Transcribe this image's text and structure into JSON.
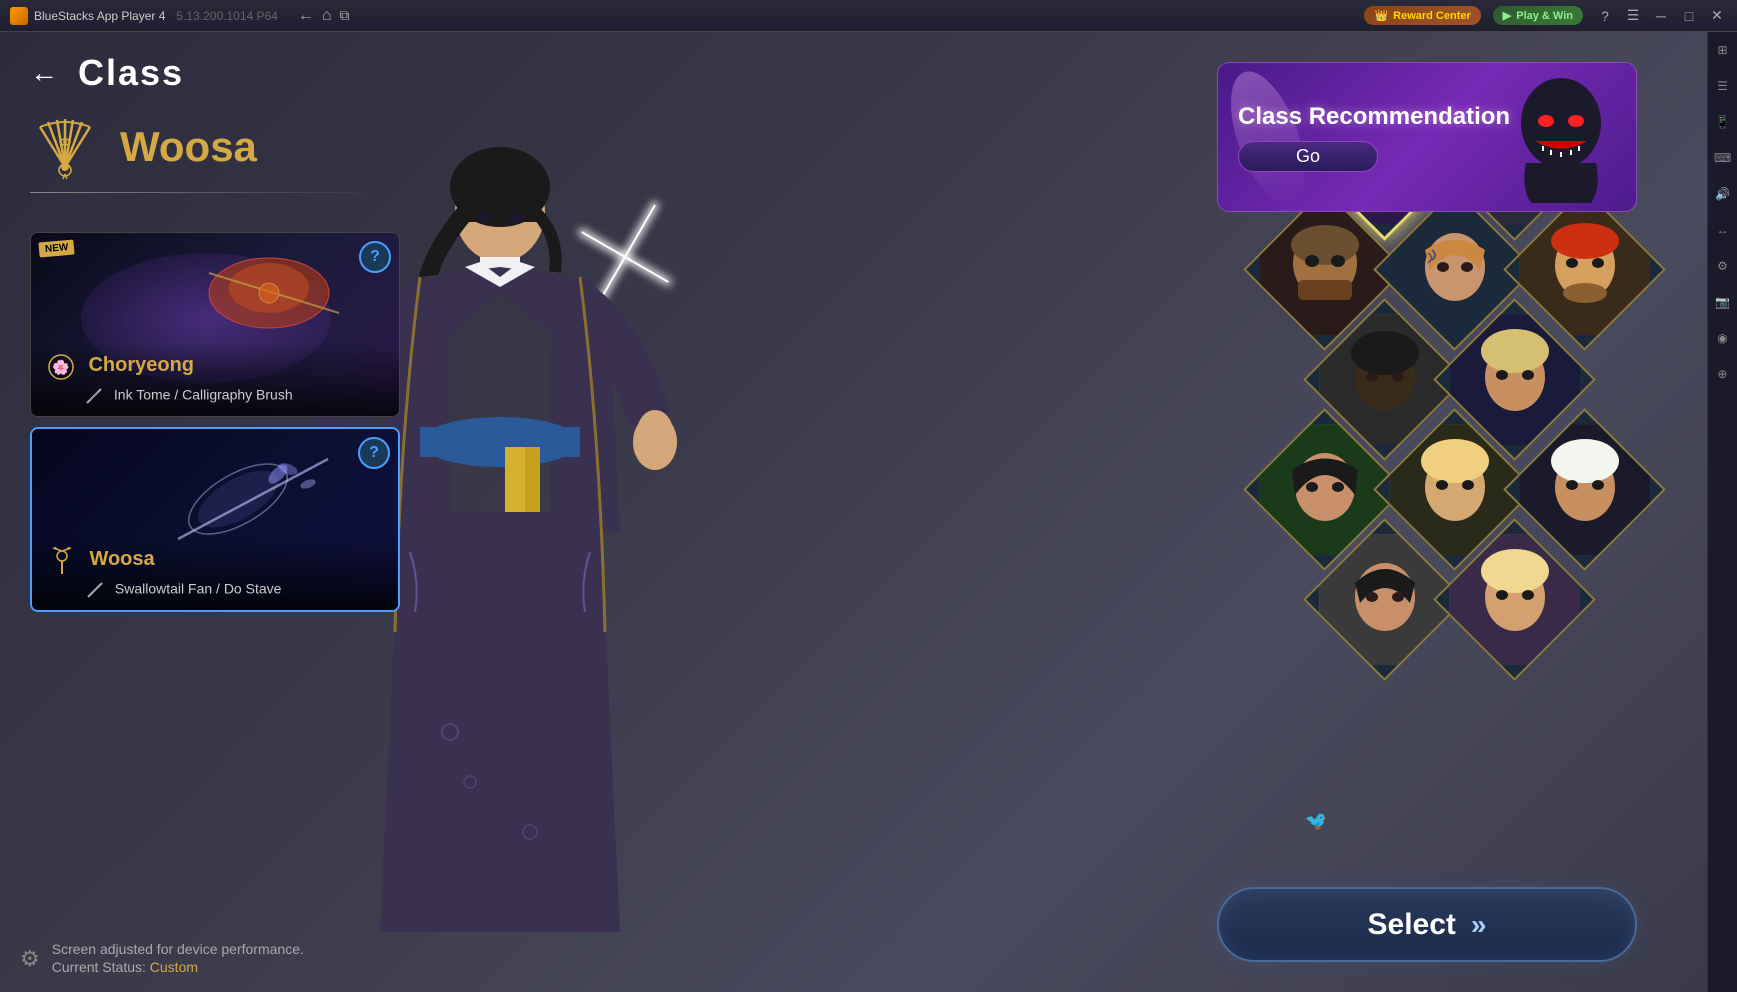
{
  "titleBar": {
    "appName": "BlueStacks App Player 4",
    "version": "5.13.200.1014 P64",
    "rewardCenter": "Reward Center",
    "playWin": "Play & Win",
    "navBack": "←",
    "navHome": "⌂",
    "navCopy": "⧉"
  },
  "header": {
    "backArrow": "←",
    "title": "Class"
  },
  "classInfo": {
    "name": "Woosa",
    "selectedClass": "Woosa",
    "divider": ""
  },
  "classCards": [
    {
      "id": "choryeong",
      "isNew": true,
      "name": "Choryeong",
      "weapon": "Ink Tome / Calligraphy Brush",
      "selected": false
    },
    {
      "id": "woosa",
      "isNew": false,
      "name": "Woosa",
      "weapon": "Swallowtail Fan / Do Stave",
      "selected": true
    }
  ],
  "recommendation": {
    "title": "Class Recommendation",
    "goButton": "Go"
  },
  "selectButton": {
    "label": "Select",
    "chevron": "»"
  },
  "statusBar": {
    "line1": "Screen adjusted for device performance.",
    "line2": "Current Status: ",
    "status": "Custom"
  },
  "questionMark": "?",
  "newBadge": "NEW",
  "classGrid": {
    "items": [
      {
        "id": "woosa",
        "isNew": true,
        "selected": true,
        "emoji": "👩",
        "color": "#4a3a6a"
      },
      {
        "id": "char2",
        "isNew": false,
        "selected": false,
        "emoji": "👱‍♀️",
        "color": "#3a3a4a"
      },
      {
        "id": "char3",
        "isNew": false,
        "selected": false,
        "emoji": "👴",
        "color": "#3a2a2a"
      },
      {
        "id": "char4",
        "isNew": false,
        "selected": false,
        "emoji": "👱‍♀️",
        "color": "#3a3a2a"
      },
      {
        "id": "char5",
        "isNew": false,
        "selected": false,
        "emoji": "🧔",
        "color": "#2a3a4a"
      },
      {
        "id": "char6",
        "isNew": false,
        "selected": false,
        "emoji": "👩‍🦰",
        "color": "#3a2a3a"
      },
      {
        "id": "char7",
        "isNew": false,
        "selected": false,
        "emoji": "👨‍🦱",
        "color": "#2a2a2a"
      },
      {
        "id": "char8",
        "isNew": false,
        "selected": false,
        "emoji": "👩‍🦳",
        "color": "#3a2a1a"
      },
      {
        "id": "char9",
        "isNew": false,
        "selected": false,
        "emoji": "👩",
        "color": "#2a3a2a"
      },
      {
        "id": "char10",
        "isNew": false,
        "selected": false,
        "emoji": "👱‍♀️",
        "color": "#2a2a3a"
      },
      {
        "id": "char11",
        "isNew": false,
        "selected": false,
        "emoji": "👩‍🦱",
        "color": "#3a3a3a"
      },
      {
        "id": "char12",
        "isNew": false,
        "selected": false,
        "emoji": "👱‍♀️",
        "color": "#3a2a4a"
      }
    ]
  }
}
